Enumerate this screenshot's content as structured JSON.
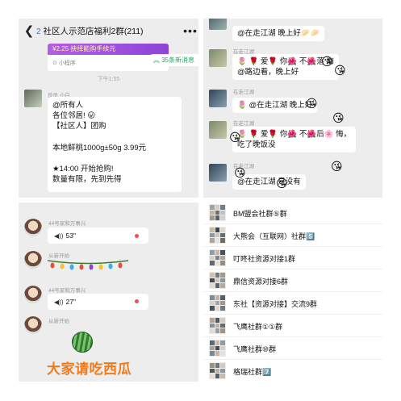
{
  "panel1": {
    "back_icon": "chevron-left-icon",
    "title_number": "2",
    "title_text": "社区人示范店福利2群(211)",
    "more_icon": "more-dots-icon",
    "mini_program_banner": "¥2.25  抉择能购手续元",
    "mini_program_label": "小程序",
    "new_messages": "35条新消息",
    "time": "下午1:55",
    "sender": "良员 小白",
    "message_lines": [
      "@所有人",
      "各位邻居! 😛",
      "【社区人】团购",
      "",
      "本地鲜桃1000g±50g  3.99元",
      "",
      "★14:00 开始抢购!",
      "数量有限，先到先得"
    ]
  },
  "panel2": {
    "messages": [
      {
        "sender": "",
        "text": "@在走江湖  晚上好🥟🥟"
      },
      {
        "sender": "在走江湖",
        "line1": "🌷 🌹 爱🌹 你🌺 不🌺落 悔",
        "line2": "@路边看，晚上好"
      },
      {
        "sender": "在走江湖",
        "text": "🌷 @在走江湖  晚上好"
      },
      {
        "sender": "在走江湖",
        "line1": "🌷 🌹 爱🌹 你🌺 不🌺后🌸 悔，",
        "line2": "吃了晚饭没"
      },
      {
        "sender": "在走江湖",
        "text": "@在走江湖  是没有"
      }
    ]
  },
  "panel3": {
    "items": [
      {
        "sender": "44号家和万事兴",
        "duration": "53\""
      },
      {
        "sender": "从新开始"
      },
      {
        "sender": "44号家和万事兴",
        "duration": "27\""
      },
      {
        "sender": "从新开始"
      }
    ],
    "watermelon_text": "大家请吃西瓜"
  },
  "panel4": {
    "groups": [
      {
        "name": "BM盟会社群⑤群"
      },
      {
        "name": "大熊会（互联网）社群5️⃣"
      },
      {
        "name": "叮咚社资源对接1群"
      },
      {
        "name": "鼎信资源对接6群"
      },
      {
        "name": "东社【资源对接】交流9群"
      },
      {
        "name": "飞鹰社群①①群"
      },
      {
        "name": "飞鹰社群⑩群"
      },
      {
        "name": "格瑞社群7️⃣"
      }
    ]
  },
  "colors": {
    "chat_bg": "#ededed",
    "bubble": "#ffffff",
    "new_msg": "#1aad5f",
    "melon_text": "#f07a1c",
    "unread_dot": "#f0514d"
  }
}
